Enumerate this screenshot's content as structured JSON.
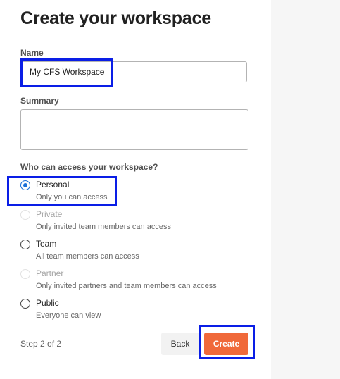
{
  "form": {
    "title": "Create your workspace",
    "name_label": "Name",
    "name_value": "My CFS Workspace",
    "summary_label": "Summary",
    "summary_value": "",
    "access_question": "Who can access your workspace?",
    "access_options": [
      {
        "label": "Personal",
        "description": "Only you can access",
        "state": "selected"
      },
      {
        "label": "Private",
        "description": "Only invited team members can access",
        "state": "disabled"
      },
      {
        "label": "Team",
        "description": "All team members can access",
        "state": "enabled"
      },
      {
        "label": "Partner",
        "description": "Only invited partners and team members can access",
        "state": "disabled"
      },
      {
        "label": "Public",
        "description": "Everyone can view",
        "state": "enabled"
      }
    ]
  },
  "footer": {
    "step_text": "Step 2 of 2",
    "back_label": "Back",
    "create_label": "Create"
  },
  "colors": {
    "primary_button": "#f0693a",
    "radio_selected": "#1a6fd8",
    "highlight_box": "#0a1ee6"
  }
}
